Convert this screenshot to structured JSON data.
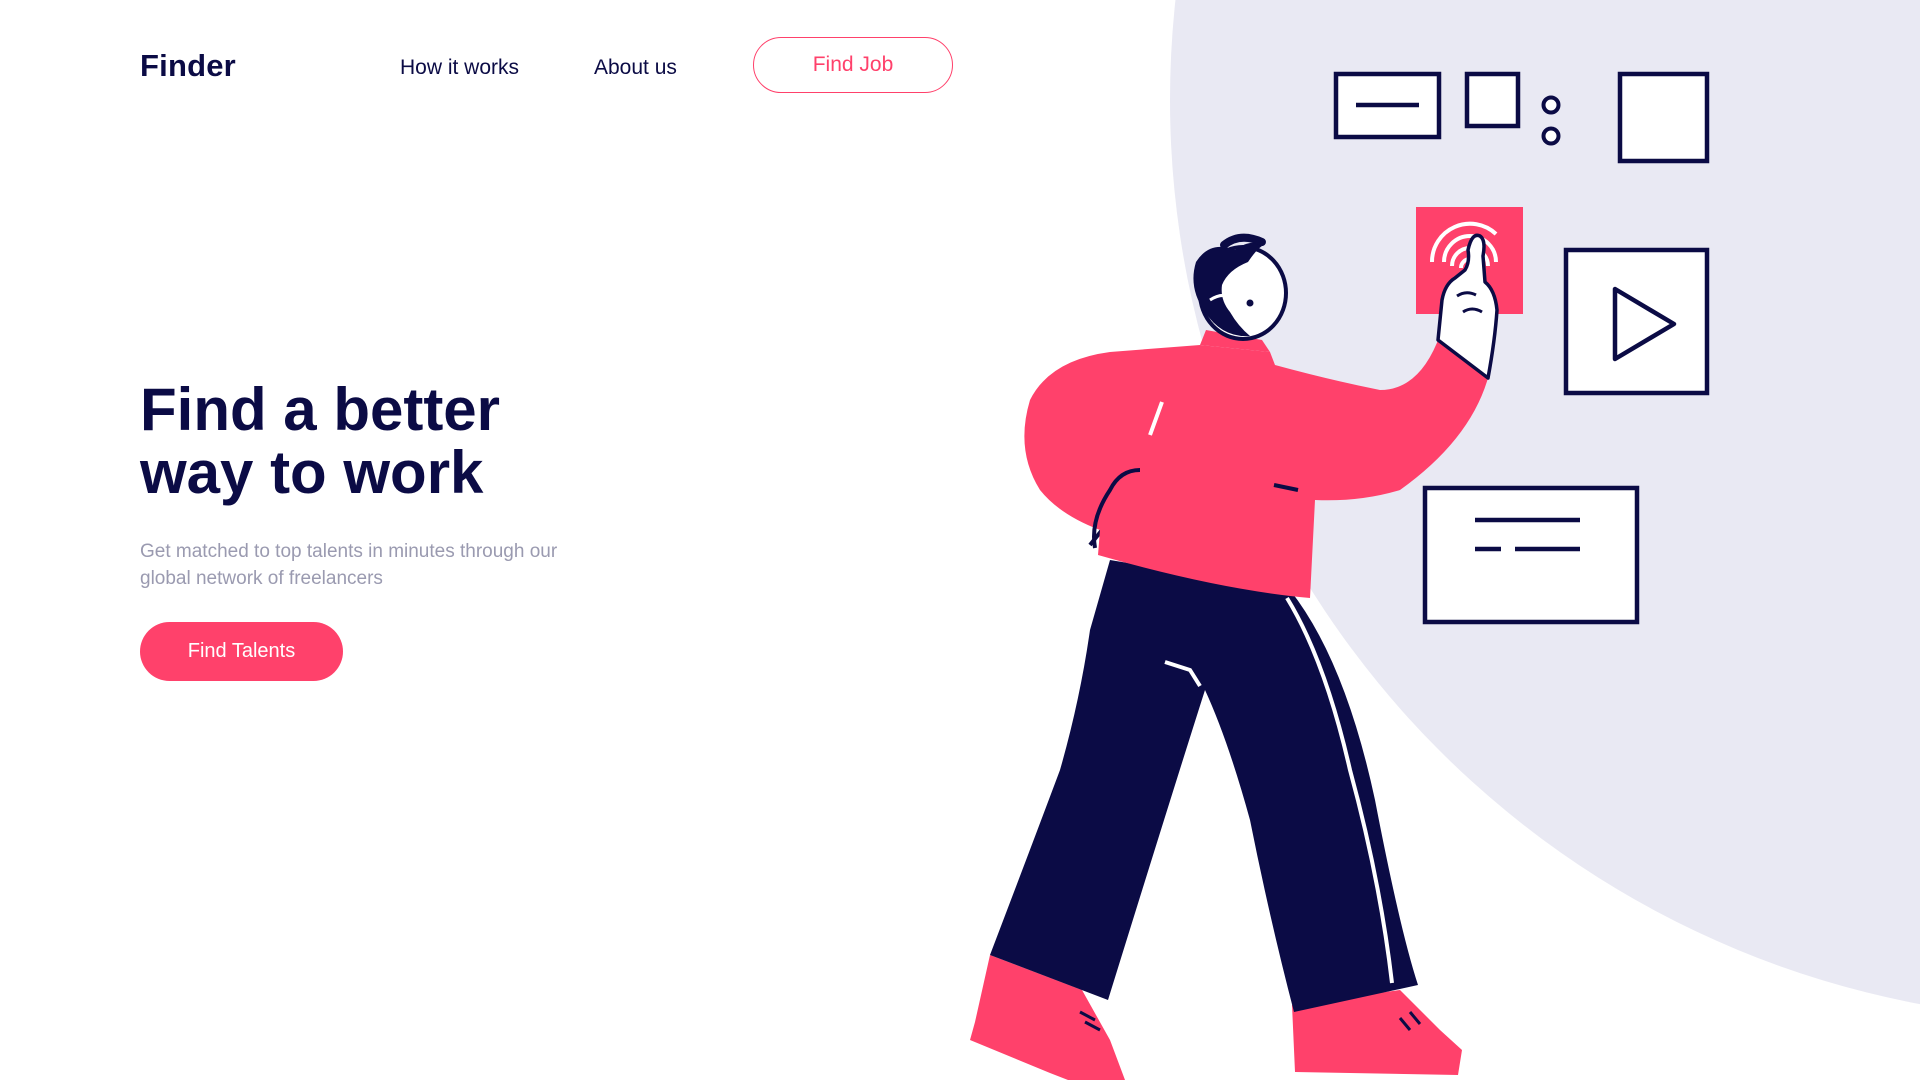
{
  "brand": {
    "name": "Finder"
  },
  "nav": {
    "links": [
      {
        "label": "How it works"
      },
      {
        "label": "About us"
      }
    ],
    "cta_label": "Find Job"
  },
  "hero": {
    "title_lines": [
      "Find a better",
      "way to work"
    ],
    "subtitle_lines": [
      "Get matched to top talents in minutes through our",
      "global network of freelancers"
    ],
    "cta_label": "Find Talents"
  },
  "colors": {
    "accent": "#ff416b",
    "navy": "#0b0b45",
    "muted_text": "#9a9ab0",
    "blob": "#e9e9f3"
  },
  "icons": [
    "text-field-icon",
    "checkbox-icon",
    "radio-options-icon",
    "image-placeholder-icon",
    "fingerprint-icon",
    "play-icon",
    "text-card-icon"
  ]
}
